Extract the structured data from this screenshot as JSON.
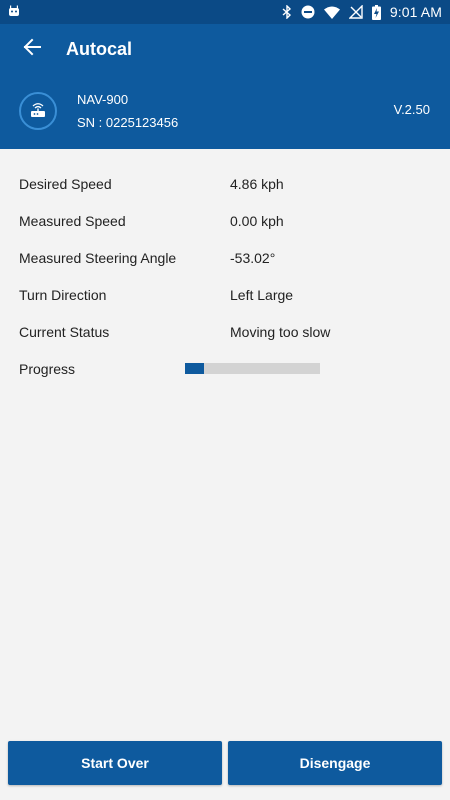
{
  "status_bar": {
    "time": "9:01 AM",
    "icons": [
      "android-icon",
      "bluetooth-icon",
      "dnd-icon",
      "wifi-icon",
      "no-signal-icon",
      "battery-charging-icon"
    ]
  },
  "app_bar": {
    "title": "Autocal",
    "back_icon": "arrow-left-icon"
  },
  "device": {
    "name": "NAV-900",
    "sn": "SN :  0225123456",
    "version": "V.2.50",
    "icon": "router-icon"
  },
  "fields": [
    {
      "label": "Desired Speed",
      "value": "4.86 kph"
    },
    {
      "label": "Measured Speed",
      "value": "0.00 kph"
    },
    {
      "label": "Measured Steering Angle",
      "value": "-53.02°"
    },
    {
      "label": "Turn Direction",
      "value": "Left Large"
    },
    {
      "label": "Current Status",
      "value": "Moving too slow"
    }
  ],
  "progress": {
    "label": "Progress",
    "value_fraction": 0.14
  },
  "buttons": {
    "start_over": "Start Over",
    "disengage": "Disengage"
  },
  "colors": {
    "primary": "#0e5a9e",
    "status_bar": "#0b4a86",
    "background": "#f3f3f3",
    "progress_track": "#d3d3d3"
  }
}
